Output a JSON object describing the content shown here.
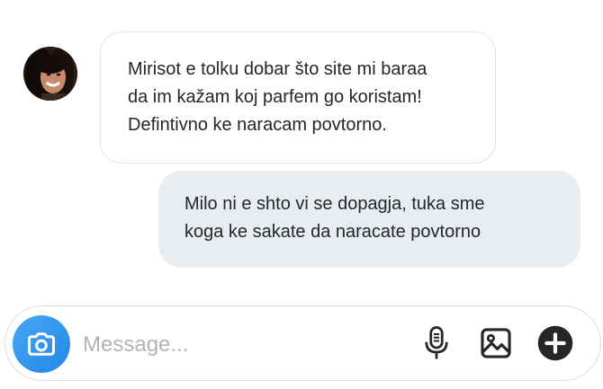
{
  "conversation": {
    "incoming": {
      "text": "Mirisot e tolku dobar što site mi baraa\nda im kažam koj parfem go koristam!\nDefintivno ke naracam povtorno."
    },
    "outgoing": {
      "text": "Milo ni e shto vi se dopagja, tuka sme\nkoga ke sakate da naracate povtorno"
    }
  },
  "composer": {
    "placeholder": "Message...",
    "value": ""
  },
  "icons": {
    "camera": "camera-icon",
    "microphone": "microphone-icon",
    "gallery": "image-icon",
    "add": "plus-circle-icon"
  },
  "colors": {
    "incoming_bubble_border": "#e3e3e3",
    "outgoing_bubble_bg": "#e9edf1",
    "camera_button": "#1f88e8",
    "icon_dark": "#262626",
    "placeholder": "#b3b3b3"
  }
}
